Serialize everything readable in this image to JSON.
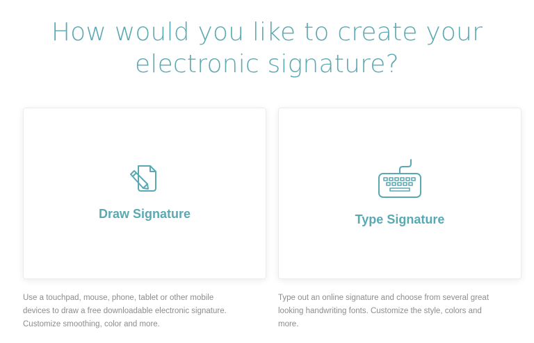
{
  "heading": {
    "line1": "How would you like to create your",
    "line2": "electronic signature?"
  },
  "colors": {
    "accent": "#5aa9b2",
    "description_text": "#8c8c8c",
    "card_border": "#ececec"
  },
  "options": {
    "draw": {
      "icon": "pencil-document-icon",
      "title": "Draw Signature",
      "description": [
        "Use a touchpad, mouse, phone, tablet or other mobile",
        "devices to draw a free downloadable electronic signature.",
        "Customize smoothing, color and more."
      ]
    },
    "type": {
      "icon": "keyboard-icon",
      "title": "Type Signature",
      "description": [
        "Type out an online signature and choose from several great",
        "looking handwriting fonts. Customize the style, colors and",
        "more."
      ]
    }
  }
}
